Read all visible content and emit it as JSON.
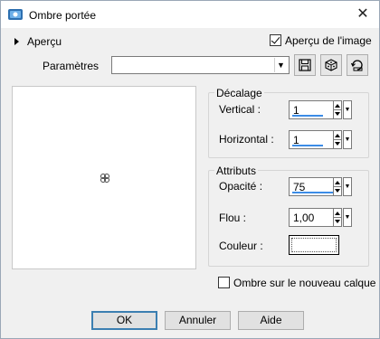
{
  "window": {
    "title": "Ombre portée",
    "close_symbol": "✕"
  },
  "preview_toggle": {
    "label": "Aperçu"
  },
  "image_preview_checkbox": {
    "label": "Aperçu de l'image",
    "checked": true
  },
  "presets": {
    "label": "Paramètres",
    "value": ""
  },
  "offset_group": {
    "title": "Décalage",
    "vertical": {
      "label": "Vertical :",
      "value": "1"
    },
    "horizontal": {
      "label": "Horizontal :",
      "value": "1"
    }
  },
  "attributes_group": {
    "title": "Attributs",
    "opacity": {
      "label": "Opacité :",
      "value": "75"
    },
    "blur": {
      "label": "Flou :",
      "value": "1,00"
    },
    "color": {
      "label": "Couleur :",
      "value": "#ffffff"
    }
  },
  "new_layer_checkbox": {
    "label": "Ombre sur le nouveau calque",
    "checked": false
  },
  "buttons": {
    "ok": "OK",
    "cancel": "Annuler",
    "help": "Aide"
  },
  "colors": {
    "accent": "#3c8ce6",
    "default_button_border": "#3c7fb1",
    "dialog_bg": "#f0f0f0"
  }
}
